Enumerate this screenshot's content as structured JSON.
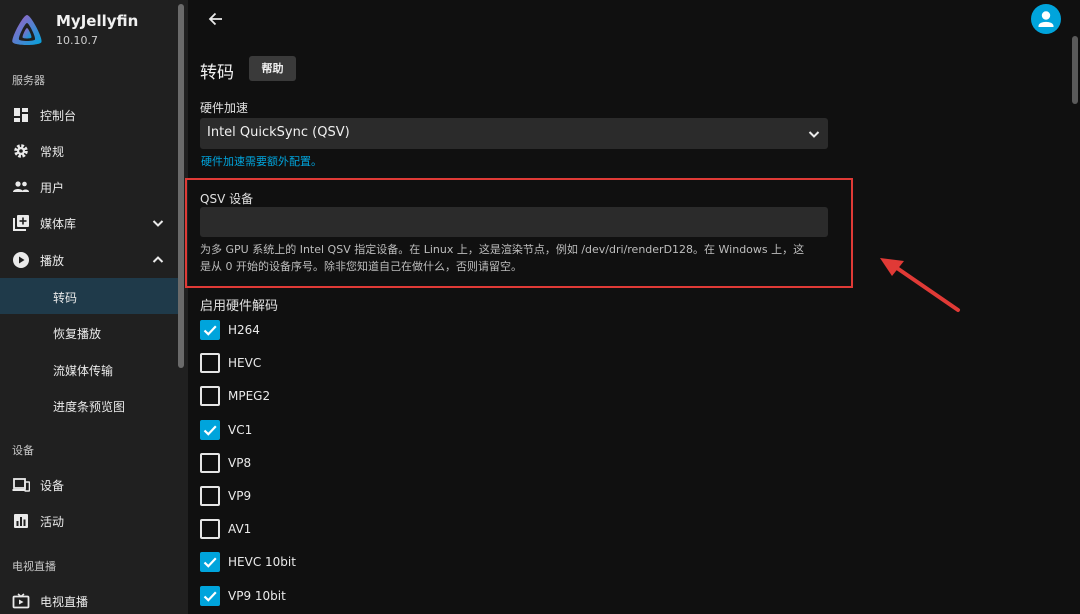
{
  "app": {
    "name": "MyJellyfin",
    "version": "10.10.7"
  },
  "sidebar": {
    "sections": {
      "server": "服务器",
      "devices": "设备",
      "livetv": "电视直播"
    },
    "items": {
      "dashboard": "控制台",
      "general": "常规",
      "users": "用户",
      "libraries": "媒体库",
      "playback": "播放",
      "devices": "设备",
      "activity": "活动",
      "livetv": "电视直播"
    },
    "playback_sub": {
      "transcoding": "转码",
      "resume": "恢复播放",
      "streaming": "流媒体传输",
      "trickplay": "进度条预览图"
    }
  },
  "page": {
    "title": "转码",
    "help_label": "帮助",
    "hw_accel_label": "硬件加速",
    "hw_accel_value": "Intel QuickSync (QSV)",
    "hw_accel_link": "硬件加速需要额外配置。",
    "qsv_label": "QSV 设备",
    "qsv_value": "",
    "qsv_desc_line1": "为多 GPU 系统上的 Intel QSV 指定设备。在 Linux 上，这是渲染节点，例如 /dev/dri/renderD128。在 Windows 上，这",
    "qsv_desc_line2": "是从 0 开始的设备序号。除非您知道自己在做什么，否则请留空。",
    "hw_decode_label": "启用硬件解码"
  },
  "codecs": [
    {
      "label": "H264",
      "checked": true
    },
    {
      "label": "HEVC",
      "checked": false
    },
    {
      "label": "MPEG2",
      "checked": false
    },
    {
      "label": "VC1",
      "checked": true
    },
    {
      "label": "VP8",
      "checked": false
    },
    {
      "label": "VP9",
      "checked": false
    },
    {
      "label": "AV1",
      "checked": false
    },
    {
      "label": "HEVC 10bit",
      "checked": true
    },
    {
      "label": "VP9 10bit",
      "checked": true
    }
  ],
  "colors": {
    "accent": "#00a4dc",
    "highlight": "#e03a36",
    "active_bg": "#1f3a4a"
  }
}
